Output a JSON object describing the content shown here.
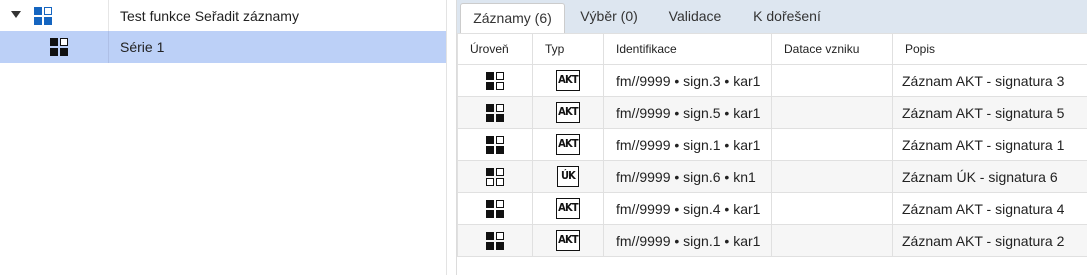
{
  "tree": {
    "items": [
      {
        "label": "Test funkce Seřadit záznamy",
        "icon": "blue-quad-icon",
        "expanded": true
      },
      {
        "label": "Série 1",
        "icon": "black-quad-icon",
        "selected": true
      }
    ]
  },
  "tabs": [
    {
      "label": "Záznamy (6)",
      "active": true
    },
    {
      "label": "Výběr (0)",
      "active": false
    },
    {
      "label": "Validace",
      "active": false
    },
    {
      "label": "K dořešení",
      "active": false
    }
  ],
  "table": {
    "columns": [
      "Úroveň",
      "Typ",
      "Identifikace",
      "Datace vzniku",
      "Popis"
    ],
    "rows": [
      {
        "level": "level-icon",
        "type": "AKT",
        "id": "fm//9999 • sign.3 • kar1",
        "date": "",
        "desc": "Záznam AKT - signatura 3"
      },
      {
        "level": "level-icon",
        "type": "AKT",
        "id": "fm//9999 • sign.5 • kar1",
        "date": "",
        "desc": "Záznam AKT - signatura 5"
      },
      {
        "level": "level-icon",
        "type": "AKT",
        "id": "fm//9999 • sign.1 • kar1",
        "date": "",
        "desc": "Záznam AKT - signatura 1"
      },
      {
        "level": "level-icon-alt",
        "type": "ÚK",
        "id": "fm//9999 • sign.6 • kn1",
        "date": "",
        "desc": "Záznam ÚK - signatura 6"
      },
      {
        "level": "level-icon",
        "type": "AKT",
        "id": "fm//9999 • sign.4 • kar1",
        "date": "",
        "desc": "Záznam AKT - signatura 4"
      },
      {
        "level": "level-icon",
        "type": "AKT",
        "id": "fm//9999 • sign.1 • kar1",
        "date": "",
        "desc": "Záznam AKT - signatura 2"
      }
    ]
  },
  "colors": {
    "selection": "#bcd0f7",
    "tabbar": "#dde6f0",
    "tree_icon": "#1565c0",
    "row_alt": "#f6f6f6"
  }
}
